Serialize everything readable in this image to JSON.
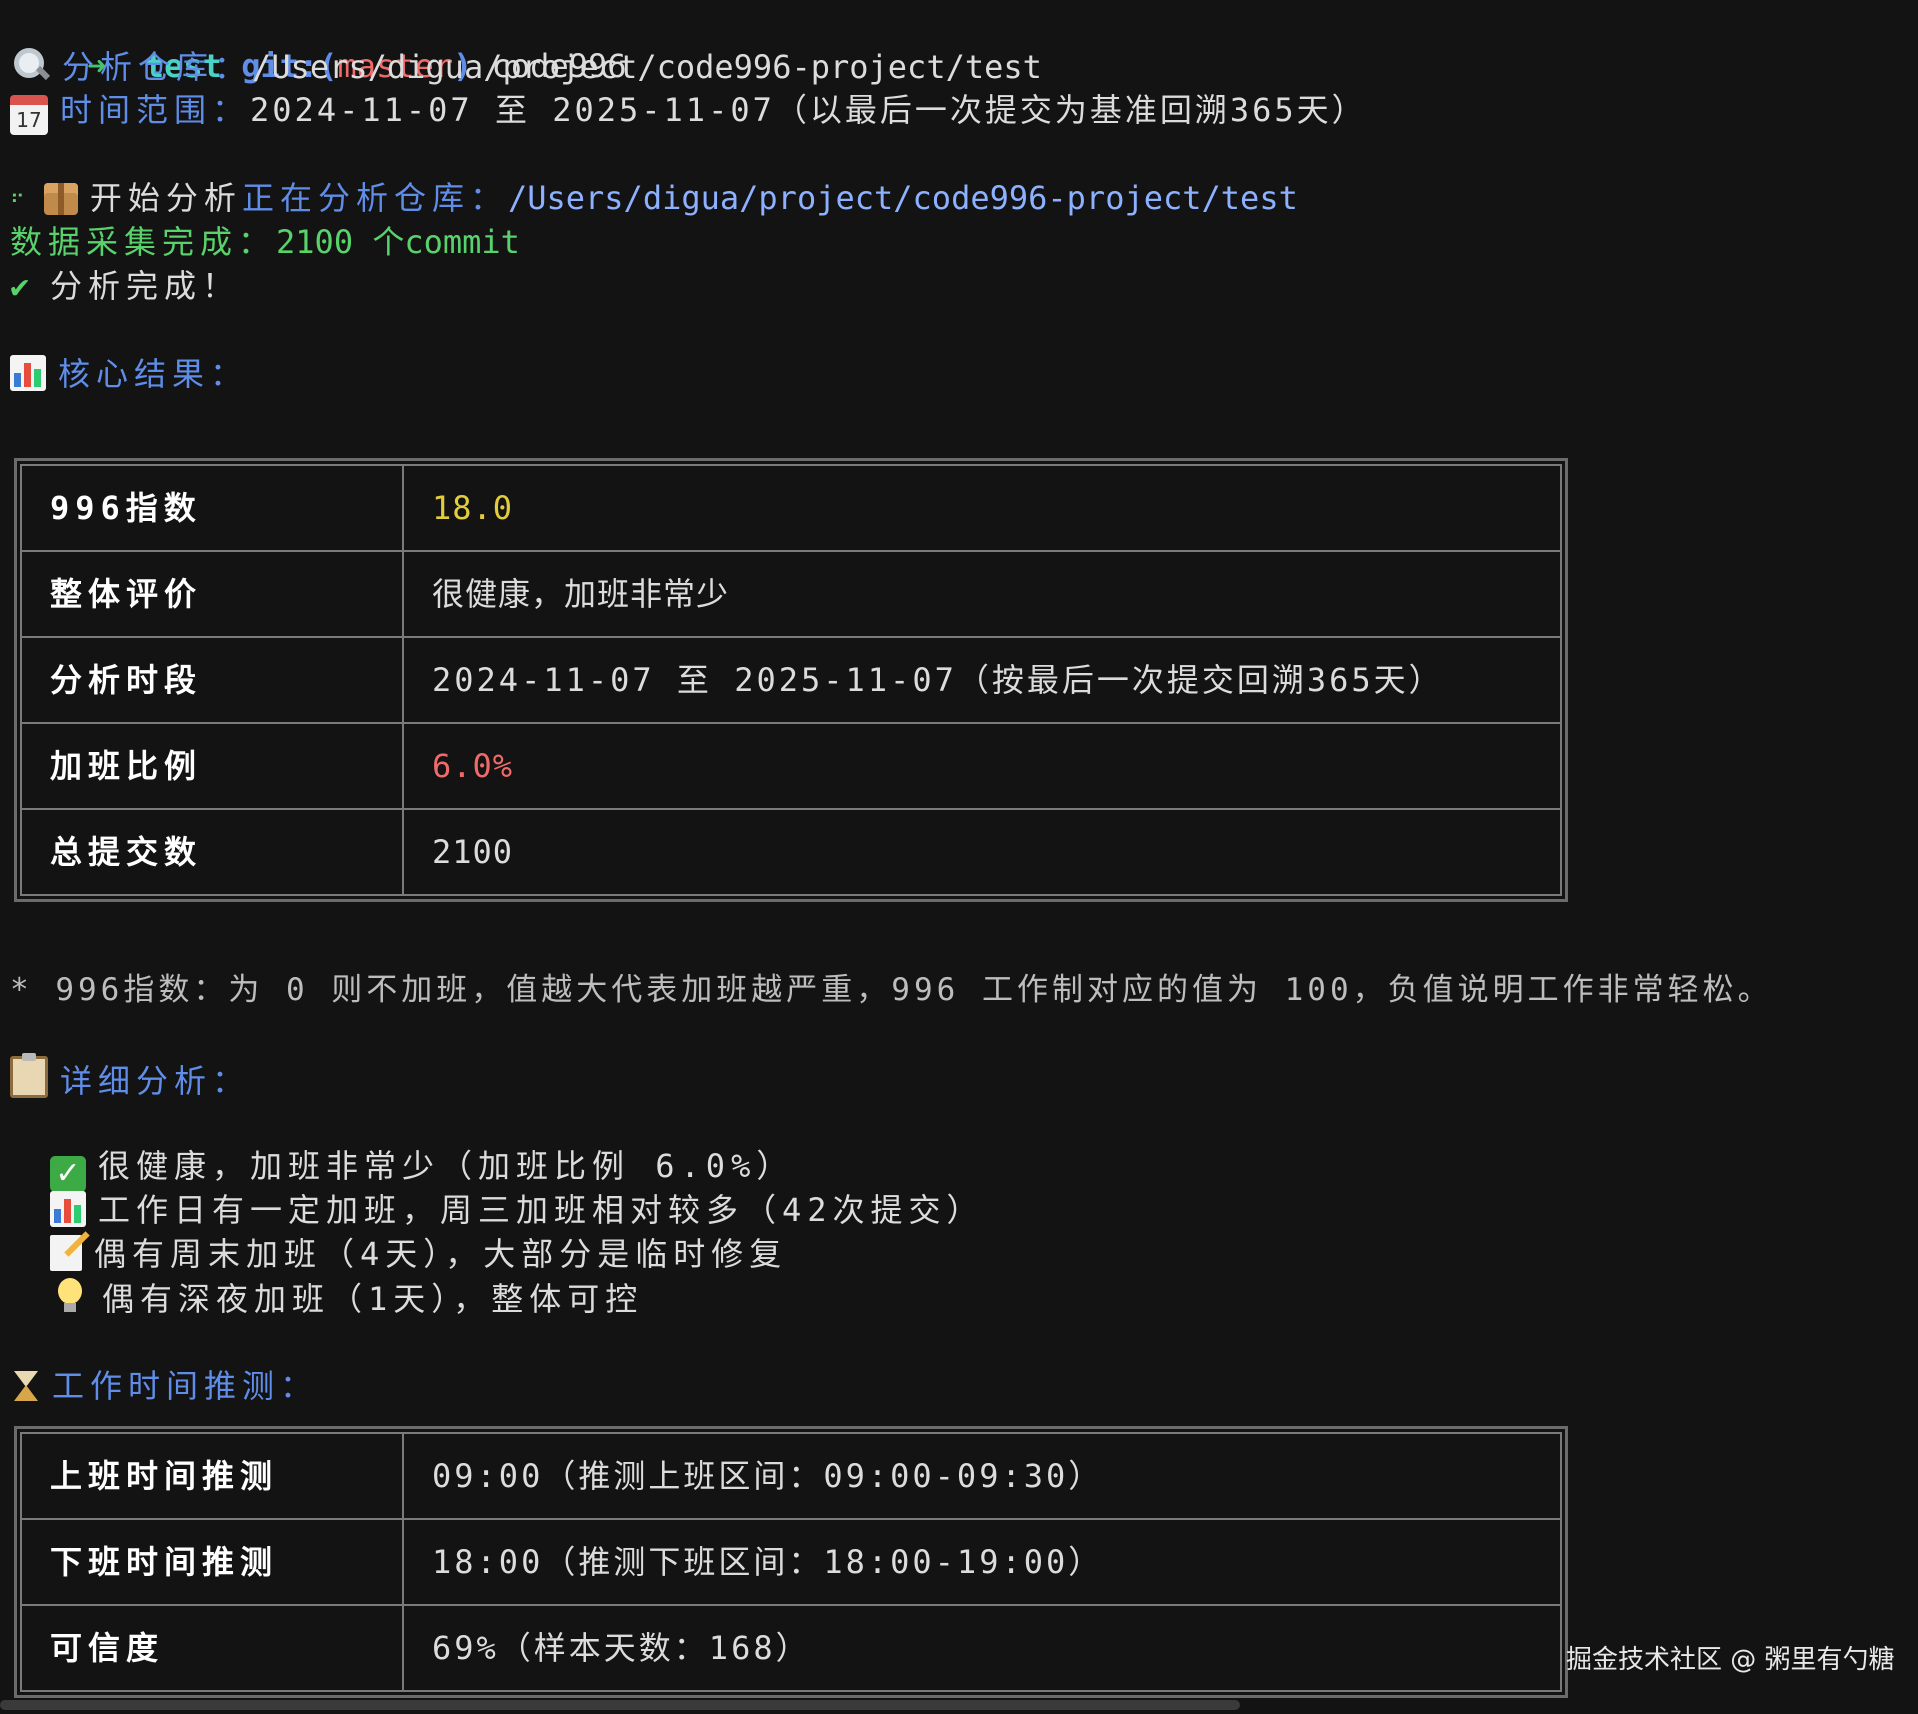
{
  "prompt": {
    "arrow": "➜",
    "dir": "test",
    "git_prefix": "git:(",
    "branch": "master",
    "git_suffix": ")",
    "command": "code996"
  },
  "repo_line": {
    "label": "分析仓库：",
    "path": "/Users/digua/project/code996-project/test"
  },
  "range_line": {
    "icon_day": "17",
    "label": "时间范围：",
    "text": "2024-11-07 至 2025-11-07（以最后一次提交为基准回溯365天）"
  },
  "analyze_line": {
    "spinner": "⠋",
    "start": "开始分析",
    "label": "正在分析仓库：",
    "path": "/Users/digua/project/code996-project/test"
  },
  "collect_line": {
    "text": "数据采集完成：",
    "count": "2100",
    "unit": "个commit"
  },
  "done_line": {
    "check": "✔",
    "text": "分析完成！"
  },
  "core": {
    "title": "核心结果：",
    "rows": [
      {
        "key": "996指数",
        "value": "18.0",
        "color": "#e3cd3b"
      },
      {
        "key": "整体评价",
        "value": "很健康，加班非常少"
      },
      {
        "key": "分析时段",
        "value": "2024-11-07 至 2025-11-07（按最后一次提交回溯365天）"
      },
      {
        "key": "加班比例",
        "value": "6.0%",
        "color": "#f06a6a"
      },
      {
        "key": "总提交数",
        "value": "2100"
      }
    ]
  },
  "footnote": "* 996指数：为 0 则不加班，值越大代表加班越严重，996 工作制对应的值为 100，负值说明工作非常轻松。",
  "detail": {
    "title": "详细分析：",
    "items": [
      {
        "icon": "check-mark-icon",
        "text": "很健康，加班非常少（加班比例 6.0%）"
      },
      {
        "icon": "bar-chart-icon",
        "text": "工作日有一定加班，周三加班相对较多（42次提交）"
      },
      {
        "icon": "memo-icon",
        "text": "偶有周末加班（4天），大部分是临时修复"
      },
      {
        "icon": "light-bulb-icon",
        "text": "偶有深夜加班（1天），整体可控"
      }
    ]
  },
  "worktime": {
    "title": "工作时间推测：",
    "rows": [
      {
        "key": "上班时间推测",
        "value": "09:00（推测上班区间：09:00-09:30）"
      },
      {
        "key": "下班时间推测",
        "value": "18:00（推测下班区间：18:00-19:00）"
      },
      {
        "key": "可信度",
        "value": "69%（样本天数：168）"
      }
    ]
  },
  "watermark": "掘金技术社区 @ 粥里有勺糖"
}
